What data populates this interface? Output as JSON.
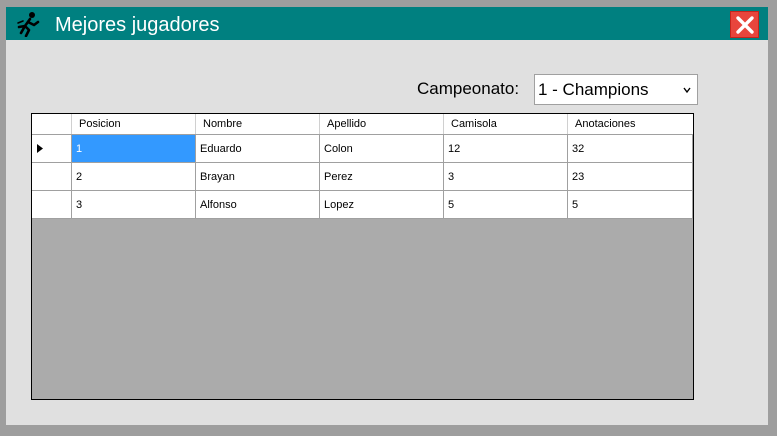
{
  "window": {
    "title": "Mejores jugadores",
    "close_icon": "close-icon",
    "app_icon": "running-player-icon"
  },
  "filter": {
    "label": "Campeonato:",
    "selected": "1 - Champions"
  },
  "table": {
    "columns": [
      "Posicion",
      "Nombre",
      "Apellido",
      "Camisola",
      "Anotaciones"
    ],
    "rows": [
      [
        "1",
        "Eduardo",
        "Colon",
        "12",
        "32"
      ],
      [
        "2",
        "Brayan",
        "Perez",
        "3",
        "23"
      ],
      [
        "3",
        "Alfonso",
        "Lopez",
        "5",
        "5"
      ]
    ],
    "selected_row": 0
  },
  "colors": {
    "titlebar": "#008080",
    "close": "#e8453c",
    "selection": "#3399ff",
    "grid_background": "#ababab"
  }
}
